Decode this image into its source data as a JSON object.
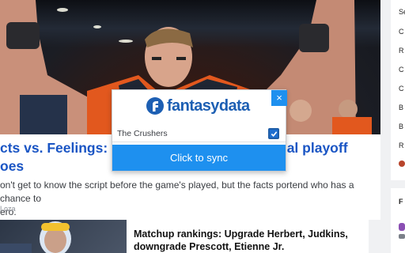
{
  "hero": {
    "caption": ""
  },
  "article": {
    "headline_line1": "cts vs. Feelings: E",
    "headline_line1_tail": "al playoff",
    "headline_line2": "oes",
    "summary_line1": "on't get to know the script before the game's played, but the facts portend who has a chance to",
    "summary_line2": "ero.",
    "byline": "Loza"
  },
  "card": {
    "title_line1": "Matchup rankings: Upgrade Herbert, Judkins,",
    "title_line2": "downgrade Prescott, Etienne Jr."
  },
  "sidebar": {
    "items": [
      "Se",
      "C",
      "R",
      "C",
      "C",
      "B",
      "B",
      "R"
    ],
    "section_label": "F"
  },
  "popup": {
    "brand": "fantasydata",
    "close_label": "×",
    "team_name": "The Crushers",
    "team_checked": true,
    "sync_label": "Click to sync",
    "colors": {
      "accent": "#1e90ef",
      "brand": "#1d5fb3"
    }
  }
}
